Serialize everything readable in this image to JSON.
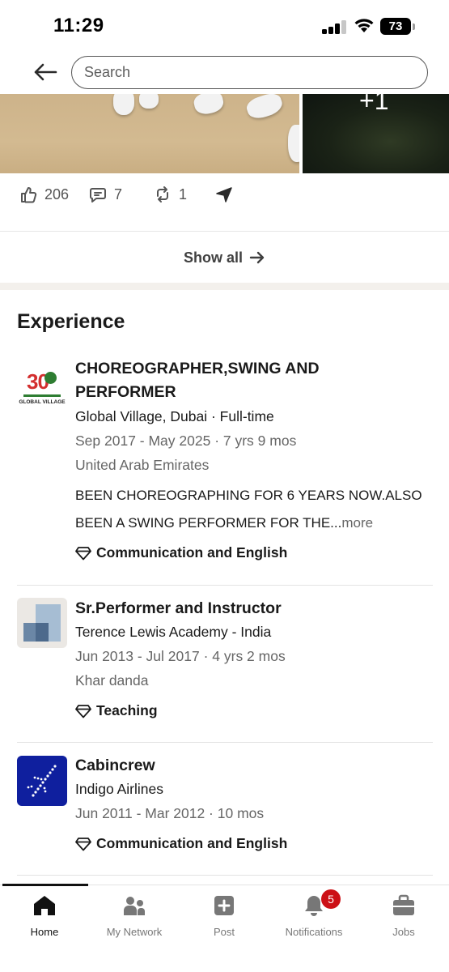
{
  "status_bar": {
    "time": "11:29",
    "battery": "73"
  },
  "header": {
    "search_placeholder": "Search"
  },
  "media": {
    "more_label": "+1"
  },
  "social": {
    "reactions": "206",
    "comments": "7",
    "reposts": "1"
  },
  "show_all": {
    "label": "Show all"
  },
  "experience": {
    "title": "Experience",
    "items": [
      {
        "role_line1": "CHOREOGRAPHER,SWING AND",
        "role_line2": "PERFORMER",
        "company": "Global Village, Dubai · Full-time",
        "dates": "Sep 2017 - May 2025 · 7 yrs 9 mos",
        "location": "United Arab Emirates",
        "desc_line1": "BEEN CHOREOGRAPHING FOR 6 YEARS NOW.ALSO",
        "desc_line2": "BEEN A SWING PERFORMER FOR THE...",
        "more": "more",
        "skill": "Communication and English",
        "logo_number": "30",
        "logo_text": "GLOBAL VILLAGE"
      },
      {
        "role": "Sr.Performer and Instructor",
        "company": "Terence Lewis Academy - India",
        "dates": "Jun 2013 - Jul 2017 · 4 yrs 2 mos",
        "location": "Khar danda",
        "skill": "Teaching"
      },
      {
        "role": "Cabincrew",
        "company": "Indigo Airlines",
        "dates": "Jun 2011 - Mar 2012 · 10 mos",
        "skill": "Communication and English"
      }
    ]
  },
  "nav": {
    "tabs": [
      {
        "label": "Home",
        "icon": "home-icon"
      },
      {
        "label": "My Network",
        "icon": "network-icon"
      },
      {
        "label": "Post",
        "icon": "post-icon"
      },
      {
        "label": "Notifications",
        "icon": "bell-icon",
        "badge": "5"
      },
      {
        "label": "Jobs",
        "icon": "briefcase-icon"
      }
    ]
  },
  "colors": {
    "accent_dark": "#111111",
    "badge": "#cc1016",
    "indigo": "#0f1f9e"
  }
}
